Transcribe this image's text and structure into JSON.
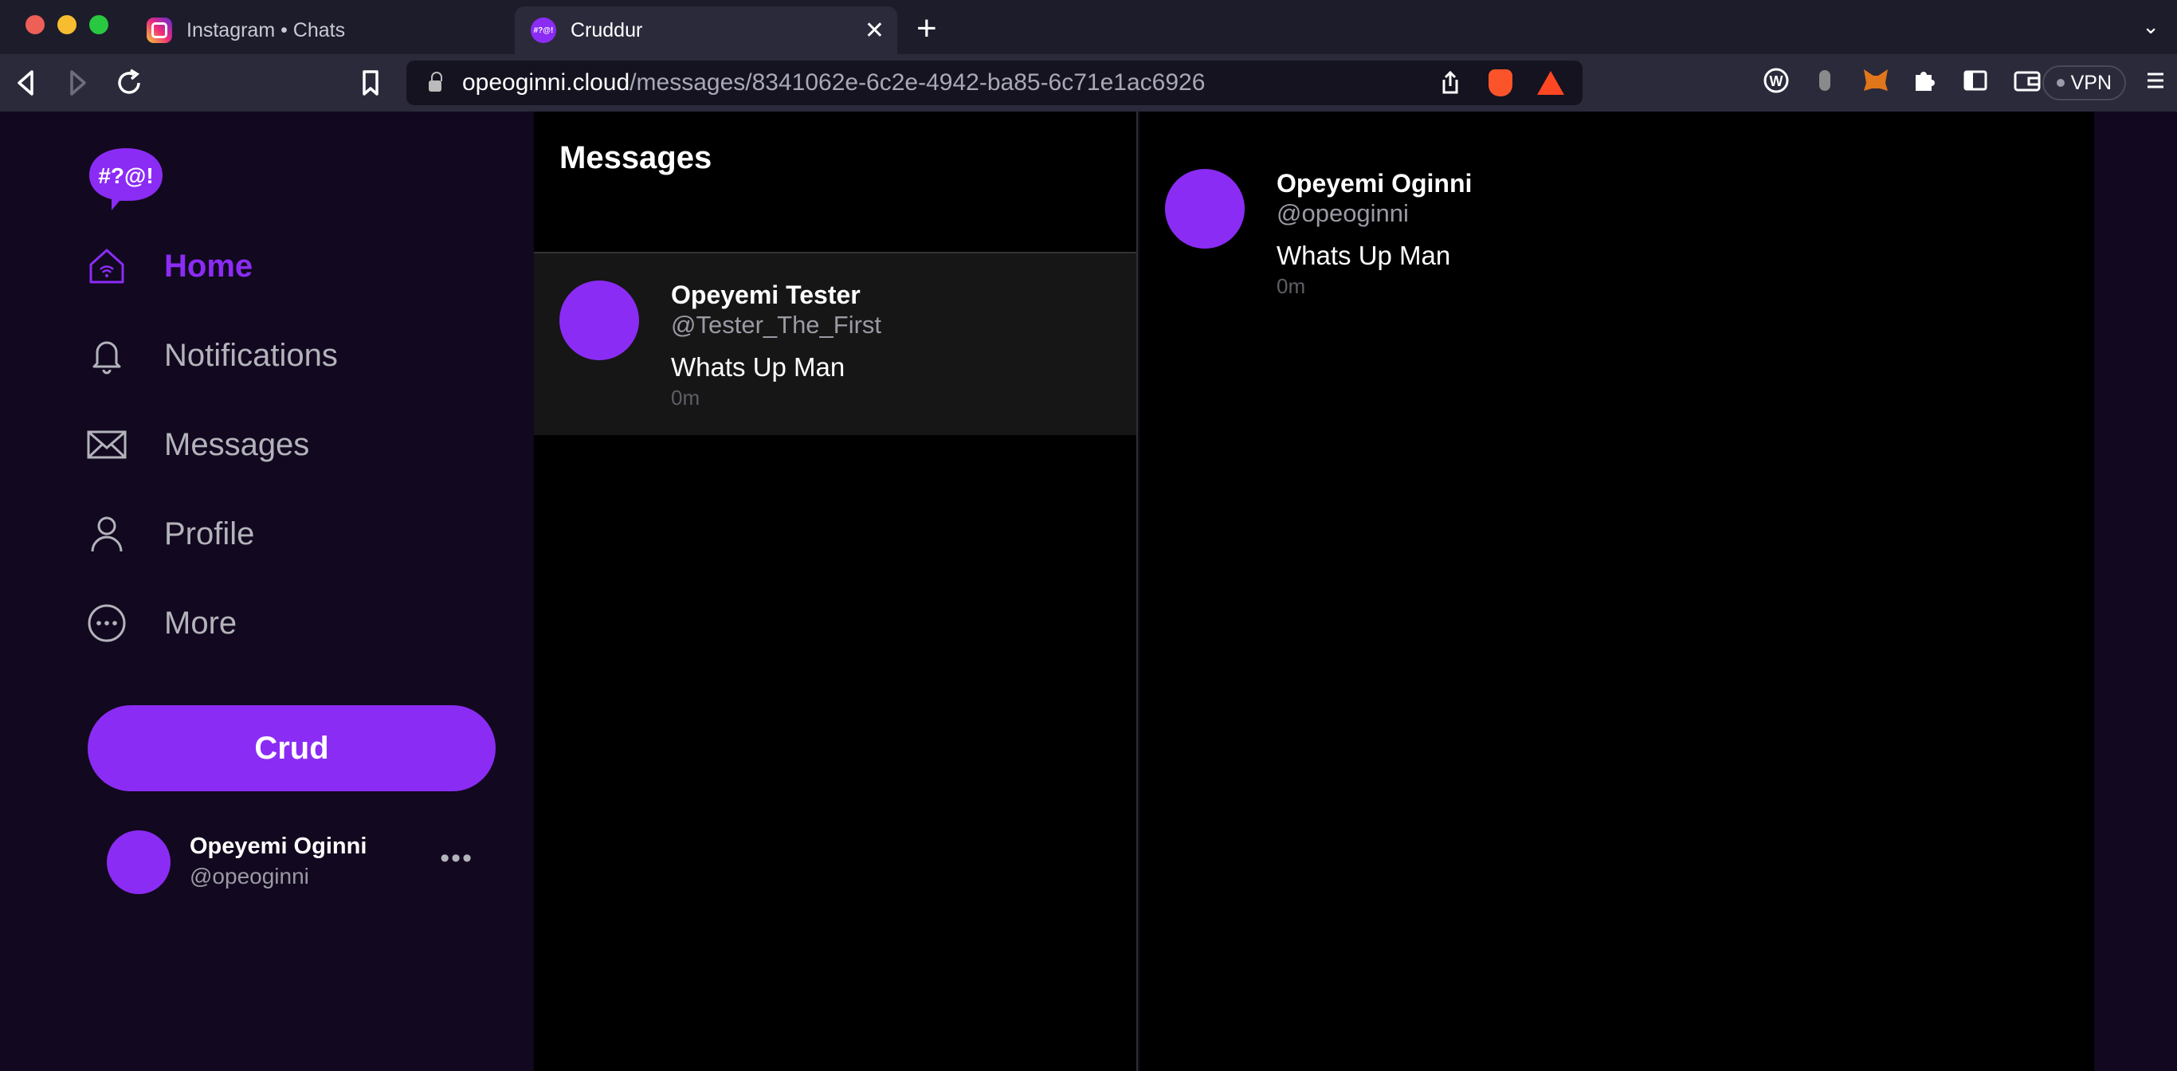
{
  "browser": {
    "tabs": [
      {
        "title": "Instagram • Chats",
        "active": false,
        "favicon": "instagram-icon"
      },
      {
        "title": "Cruddur",
        "active": true,
        "favicon": "cruddur-icon"
      }
    ],
    "favicon_text": "#?@!",
    "url": {
      "host": "opeoginni.cloud",
      "path": "/messages/8341062e-6c2e-4942-ba85-6c71e1ac6926"
    },
    "vpn_label": "VPN"
  },
  "app": {
    "logo_text": "#?@!",
    "nav": [
      {
        "label": "Home",
        "icon": "home-icon",
        "active": true
      },
      {
        "label": "Notifications",
        "icon": "bell-icon",
        "active": false
      },
      {
        "label": "Messages",
        "icon": "envelope-icon",
        "active": false
      },
      {
        "label": "Profile",
        "icon": "user-icon",
        "active": false
      },
      {
        "label": "More",
        "icon": "more-circle-icon",
        "active": false
      }
    ],
    "crud_button": "Crud",
    "current_user": {
      "name": "Opeyemi Oginni",
      "handle": "@opeoginni"
    }
  },
  "messages": {
    "title": "Messages",
    "conversations": [
      {
        "name": "Opeyemi Tester",
        "handle": "@Tester_The_First",
        "message": "Whats Up Man",
        "time": "0m"
      }
    ]
  },
  "thread": {
    "messages": [
      {
        "name": "Opeyemi Oginni",
        "handle": "@opeoginni",
        "message": "Whats Up Man",
        "time": "0m"
      }
    ]
  },
  "colors": {
    "accent": "#8b2cf5",
    "sidebar_bg": "#12081f",
    "chrome_bg": "#1d1c2b"
  }
}
